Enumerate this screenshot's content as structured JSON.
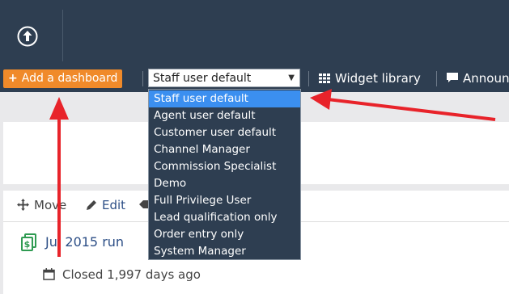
{
  "toolbar": {
    "add_dashboard_label": "Add a dashboard",
    "selected_dashboard": "Staff user default",
    "widget_library_label": "Widget library",
    "announcements_label": "Announ"
  },
  "dropdown": {
    "options": [
      "Staff user default",
      "Agent user default",
      "Customer user default",
      "Channel Manager",
      "Commission Specialist",
      "Demo",
      "Full Privilege User",
      "Lead qualification only",
      "Order entry only",
      "System Manager"
    ],
    "selected_index": 0
  },
  "widget": {
    "move_label": "Move",
    "edit_label": "Edit",
    "job_title": "Jul 2015 run",
    "closed_text": "Closed 1,997 days ago"
  },
  "colors": {
    "nav_bg": "#2e3e51",
    "accent_orange": "#f08a2a",
    "selected_blue": "#3b8ff0",
    "annotation_red": "#e8232a"
  },
  "icons": [
    "upload-icon",
    "grid-icon",
    "comment-icon",
    "move-icon",
    "pencil-icon",
    "tag-icon",
    "job-icon",
    "calendar-icon"
  ]
}
